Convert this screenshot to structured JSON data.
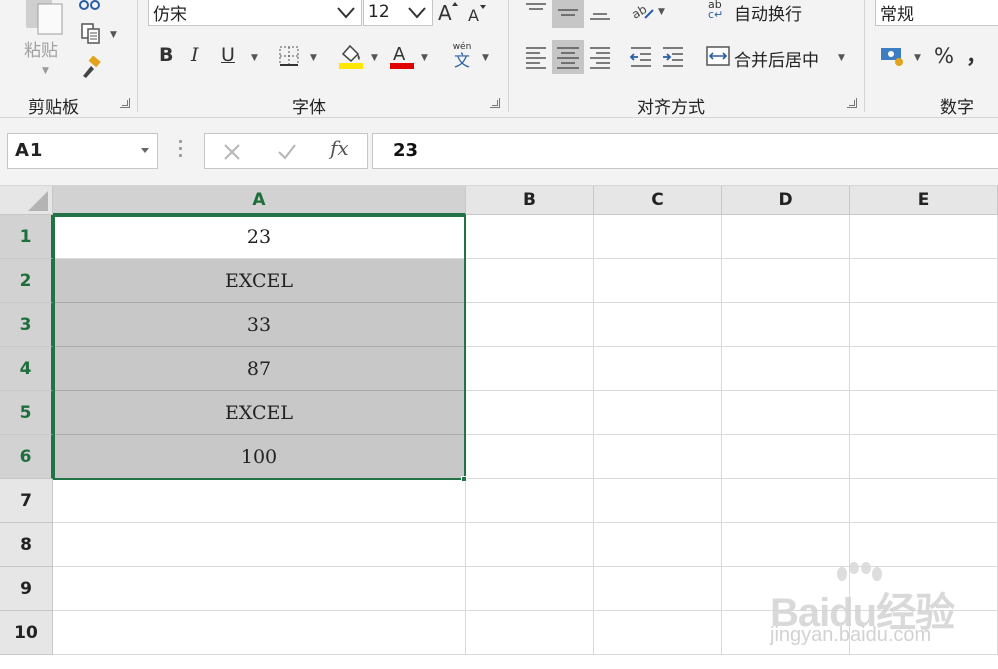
{
  "ribbon": {
    "clipboard": {
      "paste_label": "粘贴",
      "group_label": "剪贴板"
    },
    "font": {
      "font_name": "仿宋",
      "font_size": "12",
      "bold": "B",
      "italic": "I",
      "underline": "U",
      "phonetic_top": "wén",
      "phonetic_char": "文",
      "group_label": "字体",
      "fill_color": "#ffe600",
      "font_color": "#e00000"
    },
    "alignment": {
      "wrap_label": "自动换行",
      "wrap_icon_text": "ab",
      "merge_label": "合并后居中",
      "group_label": "对齐方式"
    },
    "number": {
      "format": "常规",
      "percent": "%",
      "comma": "，",
      "group_label": "数字"
    }
  },
  "formula_bar": {
    "name_box": "A1",
    "fx": "fx",
    "value": "23"
  },
  "sheet": {
    "columns": [
      "A",
      "B",
      "C",
      "D",
      "E"
    ],
    "rows": [
      "1",
      "2",
      "3",
      "4",
      "5",
      "6",
      "7",
      "8",
      "9",
      "10"
    ],
    "cells": [
      {
        "ref": "A1",
        "value": "23"
      },
      {
        "ref": "A2",
        "value": "EXCEL"
      },
      {
        "ref": "A3",
        "value": "33"
      },
      {
        "ref": "A4",
        "value": "87"
      },
      {
        "ref": "A5",
        "value": "EXCEL"
      },
      {
        "ref": "A6",
        "value": "100"
      }
    ],
    "accent": "#217346"
  },
  "watermark": {
    "logo": "Baidu经验",
    "sub": "jingyan.baidu.com"
  }
}
